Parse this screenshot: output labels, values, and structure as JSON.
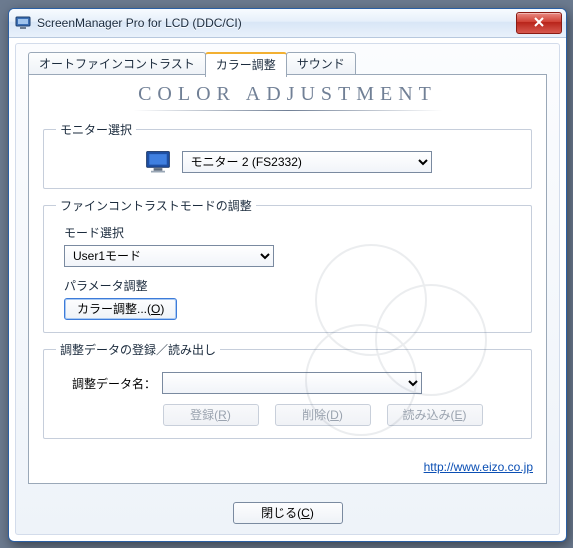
{
  "window": {
    "title": "ScreenManager Pro for LCD (DDC/CI)"
  },
  "tabs": {
    "autofine": "オートファインコントラスト",
    "color": "カラー調整",
    "sound": "サウンド"
  },
  "heading": "COLOR ADJUSTMENT",
  "monitor_section": {
    "legend": "モニター選択",
    "selected": "モニター 2 (FS2332)"
  },
  "mode_section": {
    "legend": "ファインコントラストモードの調整",
    "mode_label": "モード選択",
    "mode_selected": "User1モード",
    "param_label": "パラメータ調整",
    "color_adjust_btn": "カラー調整...",
    "color_adjust_hotkey": "O"
  },
  "data_section": {
    "legend": "調整データの登録／読み出し",
    "name_label": "調整データ名：",
    "name_value": "",
    "register_btn": "登録",
    "register_hotkey": "R",
    "delete_btn": "削除",
    "delete_hotkey": "D",
    "load_btn": "読み込み",
    "load_hotkey": "E"
  },
  "link": {
    "text": "http://www.eizo.co.jp"
  },
  "footer": {
    "close_btn": "閉じる",
    "close_hotkey": "C"
  }
}
